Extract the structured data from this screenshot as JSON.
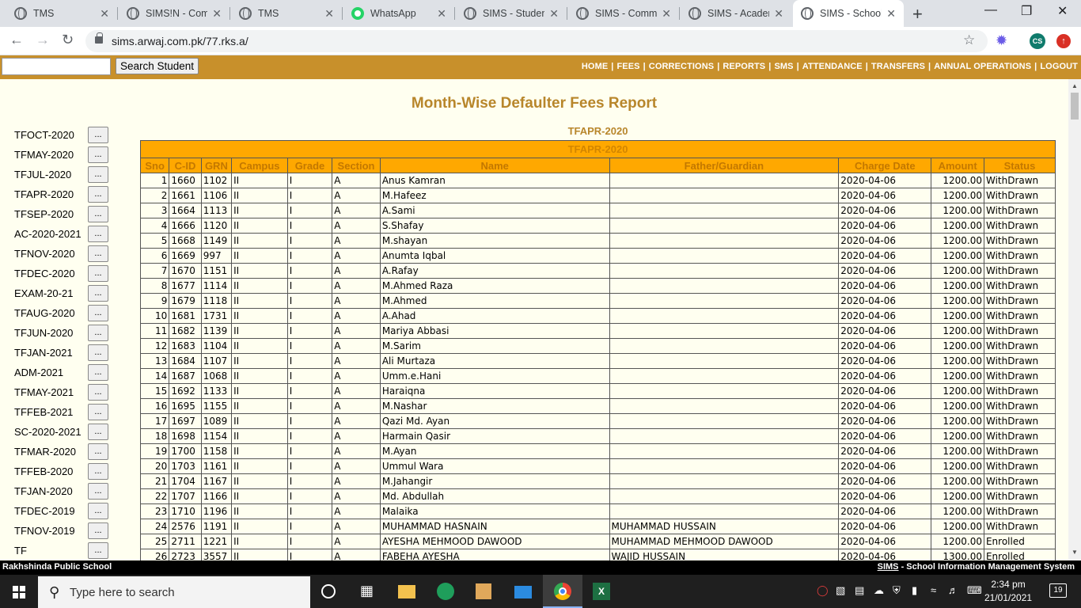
{
  "browser": {
    "tabs": [
      {
        "title": "TMS",
        "icon": "globe-icon"
      },
      {
        "title": "SIMS!N - Com",
        "icon": "globe-icon"
      },
      {
        "title": "TMS",
        "icon": "globe-icon"
      },
      {
        "title": "WhatsApp",
        "icon": "whatsapp-icon"
      },
      {
        "title": "SIMS - Student",
        "icon": "globe-icon"
      },
      {
        "title": "SIMS - Commu",
        "icon": "globe-icon"
      },
      {
        "title": "SIMS - Acaden",
        "icon": "globe-icon"
      },
      {
        "title": "SIMS - School",
        "icon": "globe-icon"
      }
    ],
    "url": "sims.arwaj.com.pk/77.rks.a/",
    "profile_initials": "CS"
  },
  "header": {
    "search_button": "Search Student",
    "search_value": "",
    "nav": [
      "HOME",
      "FEES",
      "CORRECTIONS",
      "REPORTS",
      "SMS",
      "ATTENDANCE",
      "TRANSFERS",
      "ANNUAL OPERATIONS",
      "LOGOUT"
    ]
  },
  "page": {
    "title": "Month-Wise Defaulter Fees Report",
    "subtitle": "TFAPR-2020",
    "caption": "TFAPR-2020"
  },
  "sidebar": {
    "button_label": "...",
    "items": [
      "TFOCT-2020",
      "TFMAY-2020",
      "TFJUL-2020",
      "TFAPR-2020",
      "TFSEP-2020",
      "AC-2020-2021",
      "TFNOV-2020",
      "TFDEC-2020",
      "EXAM-20-21",
      "TFAUG-2020",
      "TFJUN-2020",
      "TFJAN-2021",
      "ADM-2021",
      "TFMAY-2021",
      "TFFEB-2021",
      "SC-2020-2021",
      "TFMAR-2020",
      "TFFEB-2020",
      "TFJAN-2020",
      "TFDEC-2019",
      "TFNOV-2019",
      "TF"
    ]
  },
  "table": {
    "columns": [
      "Sno",
      "C-ID",
      "GRN",
      "Campus",
      "Grade",
      "Section",
      "Name",
      "Father/Guardian",
      "Charge Date",
      "Amount",
      "Status"
    ],
    "rows": [
      [
        "1",
        "1660",
        "1102",
        "II",
        "I",
        "A",
        "Anus Kamran",
        "",
        "2020-04-06",
        "1200.00",
        "WithDrawn"
      ],
      [
        "2",
        "1661",
        "1106",
        "II",
        "I",
        "A",
        "M.Hafeez",
        "",
        "2020-04-06",
        "1200.00",
        "WithDrawn"
      ],
      [
        "3",
        "1664",
        "1113",
        "II",
        "I",
        "A",
        "A.Sami",
        "",
        "2020-04-06",
        "1200.00",
        "WithDrawn"
      ],
      [
        "4",
        "1666",
        "1120",
        "II",
        "I",
        "A",
        "S.Shafay",
        "",
        "2020-04-06",
        "1200.00",
        "WithDrawn"
      ],
      [
        "5",
        "1668",
        "1149",
        "II",
        "I",
        "A",
        "M.shayan",
        "",
        "2020-04-06",
        "1200.00",
        "WithDrawn"
      ],
      [
        "6",
        "1669",
        "997",
        "II",
        "I",
        "A",
        "Anumta Iqbal",
        "",
        "2020-04-06",
        "1200.00",
        "WithDrawn"
      ],
      [
        "7",
        "1670",
        "1151",
        "II",
        "I",
        "A",
        "A.Rafay",
        "",
        "2020-04-06",
        "1200.00",
        "WithDrawn"
      ],
      [
        "8",
        "1677",
        "1114",
        "II",
        "I",
        "A",
        "M.Ahmed Raza",
        "",
        "2020-04-06",
        "1200.00",
        "WithDrawn"
      ],
      [
        "9",
        "1679",
        "1118",
        "II",
        "I",
        "A",
        "M.Ahmed",
        "",
        "2020-04-06",
        "1200.00",
        "WithDrawn"
      ],
      [
        "10",
        "1681",
        "1731",
        "II",
        "I",
        "A",
        "A.Ahad",
        "",
        "2020-04-06",
        "1200.00",
        "WithDrawn"
      ],
      [
        "11",
        "1682",
        "1139",
        "II",
        "I",
        "A",
        "Mariya Abbasi",
        "",
        "2020-04-06",
        "1200.00",
        "WithDrawn"
      ],
      [
        "12",
        "1683",
        "1104",
        "II",
        "I",
        "A",
        "M.Sarim",
        "",
        "2020-04-06",
        "1200.00",
        "WithDrawn"
      ],
      [
        "13",
        "1684",
        "1107",
        "II",
        "I",
        "A",
        "Ali Murtaza",
        "",
        "2020-04-06",
        "1200.00",
        "WithDrawn"
      ],
      [
        "14",
        "1687",
        "1068",
        "II",
        "I",
        "A",
        "Umm.e.Hani",
        "",
        "2020-04-06",
        "1200.00",
        "WithDrawn"
      ],
      [
        "15",
        "1692",
        "1133",
        "II",
        "I",
        "A",
        "Haraiqna",
        "",
        "2020-04-06",
        "1200.00",
        "WithDrawn"
      ],
      [
        "16",
        "1695",
        "1155",
        "II",
        "I",
        "A",
        "M.Nashar",
        "",
        "2020-04-06",
        "1200.00",
        "WithDrawn"
      ],
      [
        "17",
        "1697",
        "1089",
        "II",
        "I",
        "A",
        "Qazi Md. Ayan",
        "",
        "2020-04-06",
        "1200.00",
        "WithDrawn"
      ],
      [
        "18",
        "1698",
        "1154",
        "II",
        "I",
        "A",
        "Harmain Qasir",
        "",
        "2020-04-06",
        "1200.00",
        "WithDrawn"
      ],
      [
        "19",
        "1700",
        "1158",
        "II",
        "I",
        "A",
        "M.Ayan",
        "",
        "2020-04-06",
        "1200.00",
        "WithDrawn"
      ],
      [
        "20",
        "1703",
        "1161",
        "II",
        "I",
        "A",
        "Ummul Wara",
        "",
        "2020-04-06",
        "1200.00",
        "WithDrawn"
      ],
      [
        "21",
        "1704",
        "1167",
        "II",
        "I",
        "A",
        "M.Jahangir",
        "",
        "2020-04-06",
        "1200.00",
        "WithDrawn"
      ],
      [
        "22",
        "1707",
        "1166",
        "II",
        "I",
        "A",
        "Md. Abdullah",
        "",
        "2020-04-06",
        "1200.00",
        "WithDrawn"
      ],
      [
        "23",
        "1710",
        "1196",
        "II",
        "I",
        "A",
        "Malaika",
        "",
        "2020-04-06",
        "1200.00",
        "WithDrawn"
      ],
      [
        "24",
        "2576",
        "1191",
        "II",
        "I",
        "A",
        "MUHAMMAD HASNAIN",
        "MUHAMMAD HUSSAIN",
        "2020-04-06",
        "1200.00",
        "WithDrawn"
      ],
      [
        "25",
        "2711",
        "1221",
        "II",
        "I",
        "A",
        "AYESHA MEHMOOD DAWOOD",
        "MUHAMMAD MEHMOOD DAWOOD",
        "2020-04-06",
        "1200.00",
        "Enrolled"
      ],
      [
        "26",
        "2723",
        "3557",
        "II",
        "I",
        "A",
        "FABEHA AYESHA",
        "WAJID HUSSAIN",
        "2020-04-06",
        "1300.00",
        "Enrolled"
      ]
    ]
  },
  "statusbar": {
    "left": "Rakhshinda Public School",
    "right_link": "SIMS",
    "right_text": " - School Information Management System"
  },
  "taskbar": {
    "search_placeholder": "Type here to search",
    "time": "2:34 pm",
    "date": "21/01/2021",
    "notifications": "19"
  }
}
